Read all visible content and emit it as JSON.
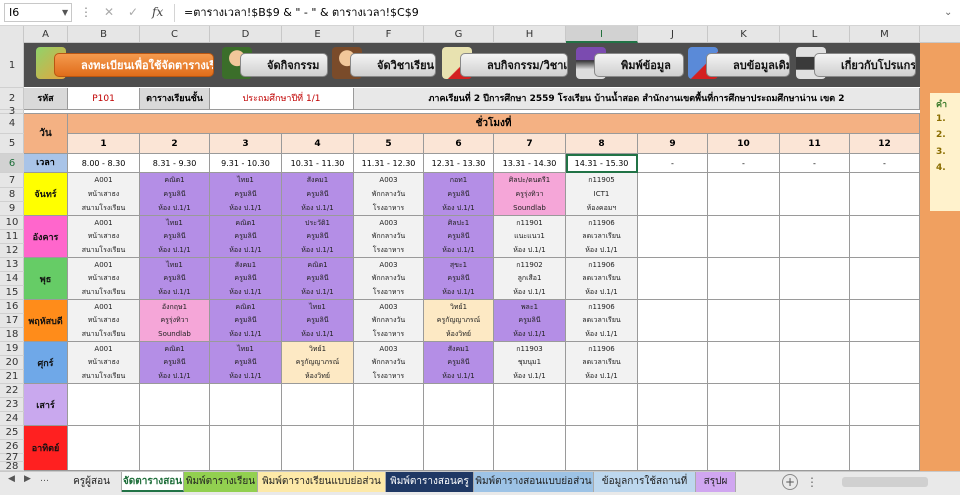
{
  "formula_bar": {
    "name_box": "I6",
    "dots": "⋮",
    "cancel": "✕",
    "enter": "✓",
    "fx": "fx",
    "formula": "=ตารางเวลา!$B$9 & \" - \" & ตารางเวลา!$C$9",
    "expand": "⌄"
  },
  "columns": [
    "A",
    "B",
    "C",
    "D",
    "E",
    "F",
    "G",
    "H",
    "I",
    "J",
    "K",
    "L",
    "M"
  ],
  "selected_column": "I",
  "rows": [
    "1",
    "2",
    "3",
    "4",
    "5",
    "6",
    "7",
    "8",
    "9",
    "10",
    "11",
    "12",
    "13",
    "14",
    "15",
    "16",
    "17",
    "18",
    "19",
    "20",
    "21",
    "22",
    "23",
    "24",
    "25",
    "26",
    "27",
    "28"
  ],
  "selected_row": "6",
  "toolbar": {
    "register_label": "ลงทะเบียนเพื่อใช้จัดตารางเรียน",
    "activities_label": "จัดกิจกรรม",
    "subjects_label": "จัดวิชาเรียน",
    "delete_activity_label": "ลบกิจกรรม/วิชาเรียน",
    "print_label": "พิมพ์ข้อมูล",
    "delete_data_label": "ลบข้อมูลเดิม",
    "about_label": "เกี่ยวกับโปรแกรม",
    "colors": {
      "accent": "#e8782a",
      "bar": "#4e4e4e"
    }
  },
  "info": {
    "code_label": "รหัส",
    "code_value": "P101",
    "class_label": "ตารางเรียนชั้น",
    "class_value": "ประถมศึกษาปีที่ 1/1",
    "school_line": "ภาคเรียนที่ 2 ปีการศึกษา 2559 โรงเรียน บ้านน้ำสอด สำนักงานเขตพื้นที่การศึกษาประถมศึกษาน่าน เขต 2"
  },
  "grid": {
    "day_header": "วัน",
    "period_header": "ชั่วโมงที่",
    "time_label": "เวลา",
    "periods": [
      "1",
      "2",
      "3",
      "4",
      "5",
      "6",
      "7",
      "8",
      "9",
      "10",
      "11",
      "12"
    ],
    "times": [
      "8.00 - 8.30",
      "8.31 - 9.30",
      "9.31 - 10.30",
      "10.31 - 11.30",
      "11.31 - 12.30",
      "12.31 - 13.30",
      "13.31 - 14.30",
      "14.31 - 15.30",
      "-",
      "-",
      "-",
      "-"
    ],
    "days": [
      {
        "name": "จันทร์",
        "color": "#ffff00",
        "slots": [
          {
            "lines": [
              "A001",
              "หน้าเสาธง",
              "สนามโรงเรียน"
            ],
            "color": "#f2f2f2"
          },
          {
            "lines": [
              "คณิต1",
              "ครูมลินี",
              "ห้อง ป.1/1"
            ],
            "color": "#b48ee6"
          },
          {
            "lines": [
              "ไทย1",
              "ครูมลินี",
              "ห้อง ป.1/1"
            ],
            "color": "#b48ee6"
          },
          {
            "lines": [
              "สังคม1",
              "ครูมลินี",
              "ห้อง ป.1/1"
            ],
            "color": "#b48ee6"
          },
          {
            "lines": [
              "A003",
              "พักกลางวัน",
              "โรงอาหาร"
            ],
            "color": "#f2f2f2"
          },
          {
            "lines": [
              "กอท1",
              "ครูมลินี",
              "ห้อง ป.1/1"
            ],
            "color": "#b48ee6"
          },
          {
            "lines": [
              "ศิลปะ/ดนตรี1",
              "ครูรุ่งทิวา",
              "Soundlab"
            ],
            "color": "#f5a6d8"
          },
          {
            "lines": [
              "ก11905",
              "ICT1",
              "ห้องคอมฯ"
            ],
            "color": "#f2f2f2"
          }
        ]
      },
      {
        "name": "อังคาร",
        "color": "#ff66cc",
        "slots": [
          {
            "lines": [
              "A001",
              "หน้าเสาธง",
              "สนามโรงเรียน"
            ],
            "color": "#f2f2f2"
          },
          {
            "lines": [
              "ไทย1",
              "ครูมลินี",
              "ห้อง ป.1/1"
            ],
            "color": "#b48ee6"
          },
          {
            "lines": [
              "คณิต1",
              "ครูมลินี",
              "ห้อง ป.1/1"
            ],
            "color": "#b48ee6"
          },
          {
            "lines": [
              "ประวัติ1",
              "ครูมลินี",
              "ห้อง ป.1/1"
            ],
            "color": "#b48ee6"
          },
          {
            "lines": [
              "A003",
              "พักกลางวัน",
              "โรงอาหาร"
            ],
            "color": "#f2f2f2"
          },
          {
            "lines": [
              "ศิลปะ1",
              "ครูมลินี",
              "ห้อง ป.1/1"
            ],
            "color": "#b48ee6"
          },
          {
            "lines": [
              "ก11901",
              "แนะแนว1",
              "ห้อง ป.1/1"
            ],
            "color": "#f2f2f2"
          },
          {
            "lines": [
              "ก11906",
              "ลดเวลาเรียน",
              "ห้อง ป.1/1"
            ],
            "color": "#f2f2f2"
          }
        ]
      },
      {
        "name": "พุธ",
        "color": "#66cc66",
        "slots": [
          {
            "lines": [
              "A001",
              "หน้าเสาธง",
              "สนามโรงเรียน"
            ],
            "color": "#f2f2f2"
          },
          {
            "lines": [
              "ไทย1",
              "ครูมลินี",
              "ห้อง ป.1/1"
            ],
            "color": "#b48ee6"
          },
          {
            "lines": [
              "สังคม1",
              "ครูมลินี",
              "ห้อง ป.1/1"
            ],
            "color": "#b48ee6"
          },
          {
            "lines": [
              "คณิต1",
              "ครูมลินี",
              "ห้อง ป.1/1"
            ],
            "color": "#b48ee6"
          },
          {
            "lines": [
              "A003",
              "พักกลางวัน",
              "โรงอาหาร"
            ],
            "color": "#f2f2f2"
          },
          {
            "lines": [
              "สุขะ1",
              "ครูมลินี",
              "ห้อง ป.1/1"
            ],
            "color": "#b48ee6"
          },
          {
            "lines": [
              "ก11902",
              "ลูกเสือ1",
              "ห้อง ป.1/1"
            ],
            "color": "#f2f2f2"
          },
          {
            "lines": [
              "ก11906",
              "ลดเวลาเรียน",
              "ห้อง ป.1/1"
            ],
            "color": "#f2f2f2"
          }
        ]
      },
      {
        "name": "พฤหัสบดี",
        "color": "#ff8c1a",
        "slots": [
          {
            "lines": [
              "A001",
              "หน้าเสาธง",
              "สนามโรงเรียน"
            ],
            "color": "#f2f2f2"
          },
          {
            "lines": [
              "อังกฤษ1",
              "ครูรุ่งทิวา",
              "Soundlab"
            ],
            "color": "#f5a6d8"
          },
          {
            "lines": [
              "คณิต1",
              "ครูมลินี",
              "ห้อง ป.1/1"
            ],
            "color": "#b48ee6"
          },
          {
            "lines": [
              "ไทย1",
              "ครูมลินี",
              "ห้อง ป.1/1"
            ],
            "color": "#b48ee6"
          },
          {
            "lines": [
              "A003",
              "พักกลางวัน",
              "โรงอาหาร"
            ],
            "color": "#f2f2f2"
          },
          {
            "lines": [
              "วิทย์1",
              "ครูกัญญาภรณ์",
              "ห้องวิทย์"
            ],
            "color": "#fde9c4"
          },
          {
            "lines": [
              "พละ1",
              "ครูมลินี",
              "ห้อง ป.1/1"
            ],
            "color": "#b48ee6"
          },
          {
            "lines": [
              "ก11906",
              "ลดเวลาเรียน",
              "ห้อง ป.1/1"
            ],
            "color": "#f2f2f2"
          }
        ]
      },
      {
        "name": "ศุกร์",
        "color": "#6fa8e8",
        "slots": [
          {
            "lines": [
              "A001",
              "หน้าเสาธง",
              "สนามโรงเรียน"
            ],
            "color": "#f2f2f2"
          },
          {
            "lines": [
              "คณิต1",
              "ครูมลินี",
              "ห้อง ป.1/1"
            ],
            "color": "#b48ee6"
          },
          {
            "lines": [
              "ไทย1",
              "ครูมลินี",
              "ห้อง ป.1/1"
            ],
            "color": "#b48ee6"
          },
          {
            "lines": [
              "วิทย์1",
              "ครูกัญญาภรณ์",
              "ห้องวิทย์"
            ],
            "color": "#fde9c4"
          },
          {
            "lines": [
              "A003",
              "พักกลางวัน",
              "โรงอาหาร"
            ],
            "color": "#f2f2f2"
          },
          {
            "lines": [
              "สังคม1",
              "ครูมลินี",
              "ห้อง ป.1/1"
            ],
            "color": "#b48ee6"
          },
          {
            "lines": [
              "ก11903",
              "ชุมนุม1",
              "ห้อง ป.1/1"
            ],
            "color": "#f2f2f2"
          },
          {
            "lines": [
              "ก11906",
              "ลดเวลาเรียน",
              "ห้อง ป.1/1"
            ],
            "color": "#f2f2f2"
          }
        ]
      },
      {
        "name": "เสาร์",
        "color": "#c9a8ee",
        "slots": []
      },
      {
        "name": "อาทิตย์",
        "color": "#ff2020",
        "slots": []
      }
    ]
  },
  "right_panel": {
    "title_char": "คำ",
    "items": [
      "1.",
      "2.",
      "3.",
      "4."
    ]
  },
  "sheet_tabs": [
    {
      "label": "ครูผู้สอน",
      "color": "#e9e9e9",
      "text": "#222"
    },
    {
      "label": "จัดตารางสอน",
      "color": "#ffffff",
      "text": "#1e6e3a",
      "active": true
    },
    {
      "label": "พิมพ์ตารางเรียน",
      "color": "#92d050",
      "text": "#222"
    },
    {
      "label": "พิมพ์ตารางเรียนแบบย่อส่วน",
      "color": "#fde9a8",
      "text": "#222"
    },
    {
      "label": "พิมพ์ตารางสอนครู",
      "color": "#1f3864",
      "text": "#ffffff"
    },
    {
      "label": "พิมพ์ตารางสอนแบบย่อส่วน",
      "color": "#9dc3e6",
      "text": "#222"
    },
    {
      "label": "ข้อมูลการใช้สถานที่",
      "color": "#bdd7ee",
      "text": "#222"
    },
    {
      "label": "สรุปผ",
      "color": "#d0a6f0",
      "text": "#222"
    }
  ],
  "tabs_nav": {
    "prev": "◀",
    "next": "▶",
    "more": "…",
    "add": "+",
    "dots": "⋮"
  }
}
